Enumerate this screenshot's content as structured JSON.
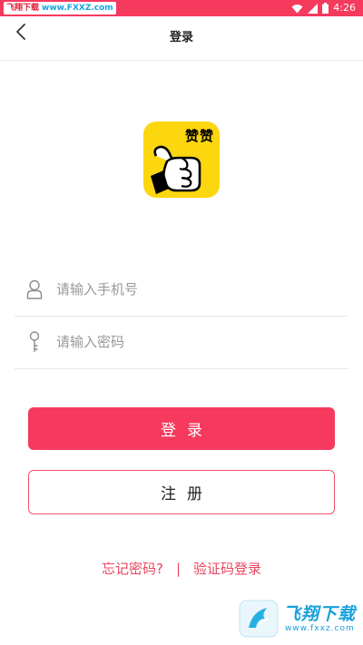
{
  "status_bar": {
    "watermark_site": "飞翔下载",
    "watermark_url": "www.FXXZ.com",
    "time": "4:26",
    "colors": {
      "background": "#f63a5e"
    },
    "icons": [
      "wifi-icon",
      "signal-icon",
      "battery-icon"
    ]
  },
  "header": {
    "title": "登录",
    "back_icon": "chevron-left-icon"
  },
  "logo": {
    "text": "赞赞",
    "icon": "thumbs-up-icon",
    "colors": {
      "background": "#fcd60f"
    }
  },
  "form": {
    "phone": {
      "placeholder": "请输入手机号",
      "value": "",
      "icon": "user-icon"
    },
    "password": {
      "placeholder": "请输入密码",
      "value": "",
      "icon": "key-icon"
    }
  },
  "buttons": {
    "login": "登录",
    "register": "注册",
    "colors": {
      "accent": "#f63a5e"
    }
  },
  "links": {
    "forgot_password": "忘记密码?",
    "separator": "|",
    "sms_login": "验证码登录"
  },
  "watermark": {
    "brand": "飞翔下载",
    "domain": "www.fxxz.com"
  }
}
